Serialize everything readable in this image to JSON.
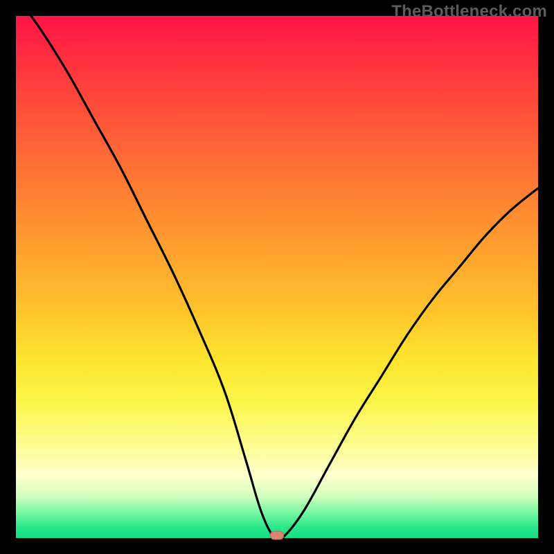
{
  "watermark": "TheBottleneck.com",
  "colors": {
    "frame": "#000000",
    "curve": "#000000",
    "marker": "#da8573",
    "gradient_top": "#ff1446",
    "gradient_bottom": "#11df82"
  },
  "chart_data": {
    "type": "line",
    "title": "",
    "xlabel": "",
    "ylabel": "",
    "xlim": [
      0,
      1
    ],
    "ylim": [
      0,
      1
    ],
    "series": [
      {
        "name": "bottleneck-curve",
        "x": [
          0.0,
          0.05,
          0.1,
          0.15,
          0.2,
          0.25,
          0.3,
          0.35,
          0.4,
          0.44,
          0.47,
          0.495,
          0.51,
          0.55,
          0.6,
          0.65,
          0.7,
          0.75,
          0.8,
          0.85,
          0.9,
          0.95,
          1.0
        ],
        "values": [
          1.04,
          0.97,
          0.89,
          0.8,
          0.71,
          0.61,
          0.51,
          0.4,
          0.28,
          0.15,
          0.05,
          0.0,
          0.0,
          0.05,
          0.14,
          0.23,
          0.31,
          0.39,
          0.46,
          0.52,
          0.58,
          0.63,
          0.67
        ]
      }
    ],
    "annotations": [
      {
        "name": "optimum-marker",
        "x": 0.5,
        "y": 0.005
      }
    ]
  }
}
